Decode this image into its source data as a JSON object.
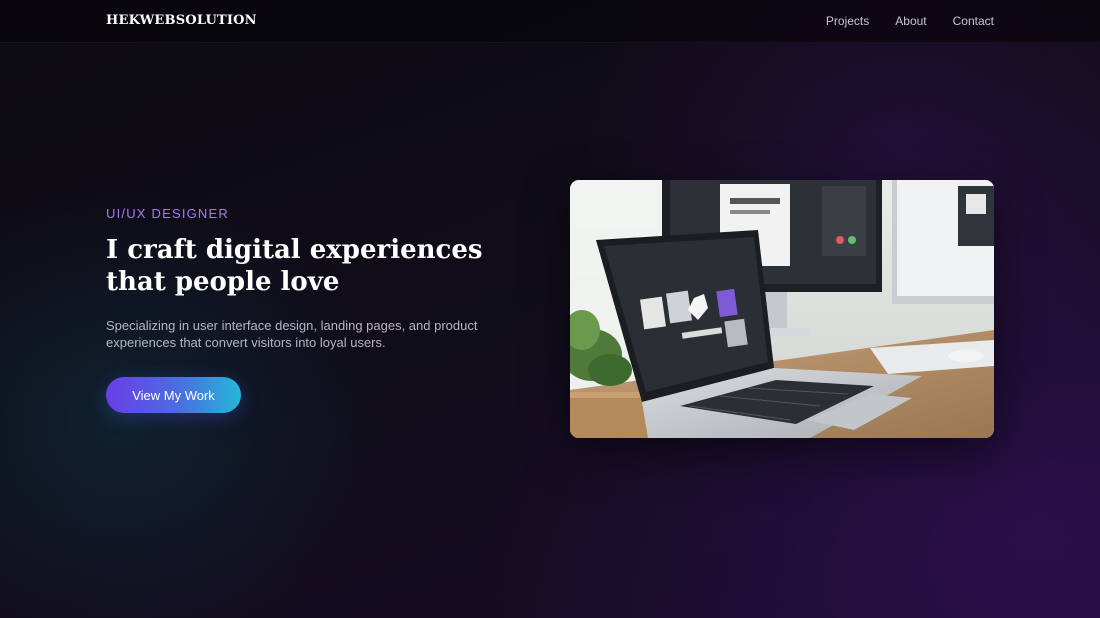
{
  "nav": {
    "brand": "HEKWEBSOLUTION",
    "links": [
      {
        "label": "Projects"
      },
      {
        "label": "About"
      },
      {
        "label": "Contact"
      }
    ]
  },
  "hero": {
    "eyebrow": "UI/UX DESIGNER",
    "headline": "I craft digital experiences that people love",
    "subtext": "Specializing in user interface design, landing pages, and product experiences that convert visitors into loyal users.",
    "cta_label": "View My Work"
  },
  "hero_image": {
    "alt": "Laptop and desktop monitors on a wooden desk"
  },
  "colors": {
    "accent": "#a978f0",
    "cta_gradient_start": "#6a3de8",
    "cta_gradient_end": "#22b8d8",
    "background": "#0e0b15"
  }
}
